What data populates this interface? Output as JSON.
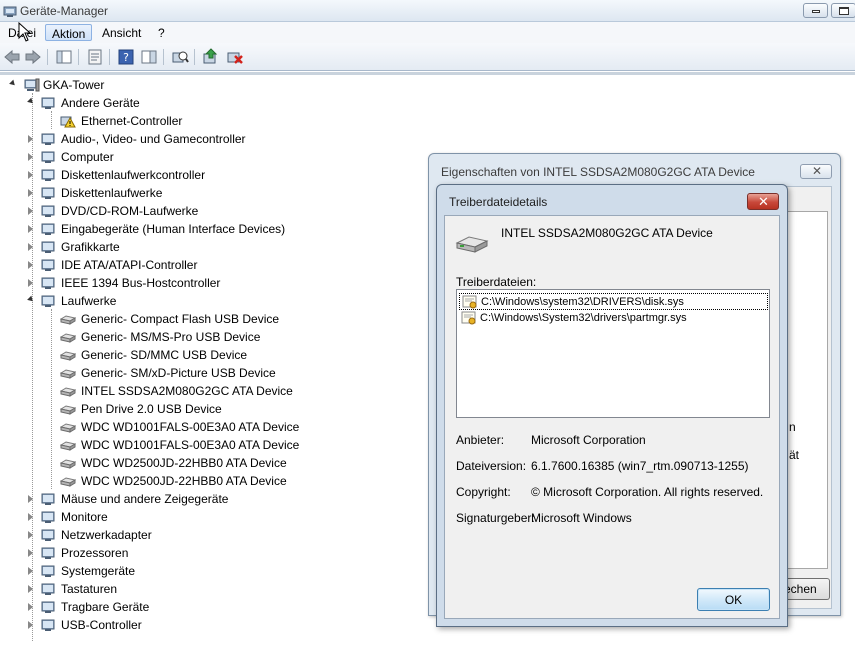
{
  "window": {
    "title": "Geräte-Manager"
  },
  "menu": [
    {
      "label": "Datei"
    },
    {
      "label": "Aktion"
    },
    {
      "label": "Ansicht"
    },
    {
      "label": "?"
    }
  ],
  "tree": {
    "root": "GKA-Tower",
    "items": [
      {
        "label": "Andere Geräte",
        "state": "expanded",
        "level": 1
      },
      {
        "label": "Ethernet-Controller",
        "level": 2,
        "warning": true
      },
      {
        "label": "Audio-, Video- und Gamecontroller",
        "state": "collapsed",
        "level": 1
      },
      {
        "label": "Computer",
        "state": "collapsed",
        "level": 1
      },
      {
        "label": "Diskettenlaufwerkcontroller",
        "state": "collapsed",
        "level": 1
      },
      {
        "label": "Diskettenlaufwerke",
        "state": "collapsed",
        "level": 1
      },
      {
        "label": "DVD/CD-ROM-Laufwerke",
        "state": "collapsed",
        "level": 1
      },
      {
        "label": "Eingabegeräte (Human Interface Devices)",
        "state": "collapsed",
        "level": 1
      },
      {
        "label": "Grafikkarte",
        "state": "collapsed",
        "level": 1
      },
      {
        "label": "IDE ATA/ATAPI-Controller",
        "state": "collapsed",
        "level": 1
      },
      {
        "label": "IEEE 1394 Bus-Hostcontroller",
        "state": "collapsed",
        "level": 1
      },
      {
        "label": "Laufwerke",
        "state": "expanded",
        "level": 1
      },
      {
        "label": "Generic- Compact Flash USB Device",
        "level": 2
      },
      {
        "label": "Generic- MS/MS-Pro USB Device",
        "level": 2
      },
      {
        "label": "Generic- SD/MMC USB Device",
        "level": 2
      },
      {
        "label": "Generic- SM/xD-Picture USB Device",
        "level": 2
      },
      {
        "label": "INTEL SSDSA2M080G2GC ATA Device",
        "level": 2
      },
      {
        "label": "Pen Drive 2.0 USB Device",
        "level": 2
      },
      {
        "label": "WDC WD1001FALS-00E3A0 ATA Device",
        "level": 2
      },
      {
        "label": "WDC WD1001FALS-00E3A0 ATA Device",
        "level": 2
      },
      {
        "label": "WDC WD2500JD-22HBB0 ATA Device",
        "level": 2
      },
      {
        "label": "WDC WD2500JD-22HBB0 ATA Device",
        "level": 2
      },
      {
        "label": "Mäuse und andere Zeigegeräte",
        "state": "collapsed",
        "level": 1
      },
      {
        "label": "Monitore",
        "state": "collapsed",
        "level": 1
      },
      {
        "label": "Netzwerkadapter",
        "state": "collapsed",
        "level": 1
      },
      {
        "label": "Prozessoren",
        "state": "collapsed",
        "level": 1
      },
      {
        "label": "Systemgeräte",
        "state": "collapsed",
        "level": 1
      },
      {
        "label": "Tastaturen",
        "state": "collapsed",
        "level": 1
      },
      {
        "label": "Tragbare Geräte",
        "state": "collapsed",
        "level": 1
      },
      {
        "label": "USB-Controller",
        "state": "collapsed",
        "level": 1
      }
    ]
  },
  "properties_dialog": {
    "title": "Eigenschaften von INTEL SSDSA2M080G2GC ATA Device",
    "close_label": "✕",
    "peek_text_1": "n",
    "peek_text_2": "ät",
    "button_label": "echen"
  },
  "driver_dialog": {
    "title": "Treiberdateidetails",
    "close_label": "✕",
    "device_name": "INTEL SSDSA2M080G2GC ATA Device",
    "files_label": "Treiberdateien:",
    "files": [
      "C:\\Windows\\system32\\DRIVERS\\disk.sys",
      "C:\\Windows\\System32\\drivers\\partmgr.sys"
    ],
    "provider_label": "Anbieter:",
    "provider_value": "Microsoft Corporation",
    "version_label": "Dateiversion:",
    "version_value": "6.1.7600.16385 (win7_rtm.090713-1255)",
    "copyright_label": "Copyright:",
    "copyright_value": "© Microsoft Corporation. All rights reserved.",
    "signer_label": "Signaturgeber:",
    "signer_value": "Microsoft Windows",
    "ok_label": "OK"
  }
}
